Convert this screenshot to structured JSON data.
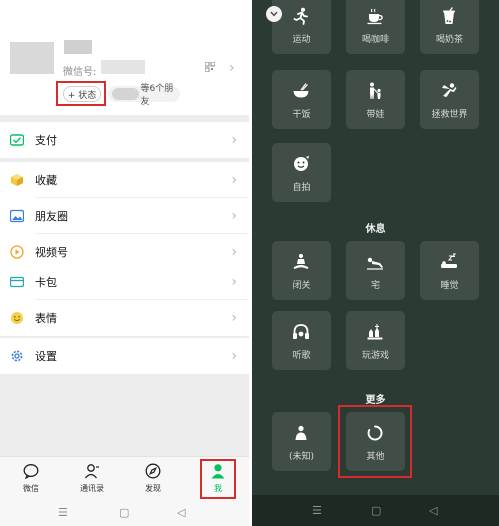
{
  "left": {
    "profile": {
      "wechat_id_label": "微信号:",
      "status_button": "+ 状态",
      "friends_suffix": "等6个朋友"
    },
    "menu": [
      {
        "label": "支付",
        "icon": "pay-icon"
      },
      {
        "label": "收藏",
        "icon": "favorites-cube-icon"
      },
      {
        "label": "朋友圈",
        "icon": "moments-image-icon"
      },
      {
        "label": "视频号",
        "icon": "channels-play-icon"
      },
      {
        "label": "卡包",
        "icon": "card-wallet-icon"
      },
      {
        "label": "表情",
        "icon": "emoji-smile-icon"
      },
      {
        "label": "设置",
        "icon": "settings-gear-icon"
      }
    ],
    "tabs": [
      {
        "label": "微信",
        "icon": "chat-bubble-icon"
      },
      {
        "label": "通讯录",
        "icon": "contacts-icon"
      },
      {
        "label": "发现",
        "icon": "compass-icon"
      },
      {
        "label": "我",
        "icon": "person-icon",
        "active": true
      }
    ]
  },
  "right": {
    "top_tiles": [
      {
        "label": "运动",
        "icon": "running-icon"
      },
      {
        "label": "喝咖啡",
        "icon": "coffee-icon"
      },
      {
        "label": "喝奶茶",
        "icon": "milk-tea-icon"
      },
      {
        "label": "干饭",
        "icon": "rice-bowl-icon"
      },
      {
        "label": "带娃",
        "icon": "parent-child-icon"
      },
      {
        "label": "拯救世界",
        "icon": "superhero-icon"
      },
      {
        "label": "自拍",
        "icon": "selfie-icon"
      }
    ],
    "sections": {
      "rest": {
        "title": "休息",
        "tiles": [
          {
            "label": "闭关",
            "icon": "meditate-icon"
          },
          {
            "label": "宅",
            "icon": "lying-down-icon"
          },
          {
            "label": "睡觉",
            "icon": "sleep-icon"
          },
          {
            "label": "听歌",
            "icon": "headphones-icon"
          },
          {
            "label": "玩游戏",
            "icon": "game-pieces-icon"
          }
        ]
      },
      "more": {
        "title": "更多",
        "tiles": [
          {
            "label": "(未知)",
            "icon": "unknown-person-icon"
          },
          {
            "label": "其他",
            "icon": "circle-other-icon"
          }
        ]
      }
    }
  },
  "colors": {
    "wechat_green": "#07c160",
    "highlight_red": "#d62c2c",
    "picker_bg": "#2b3a33"
  }
}
